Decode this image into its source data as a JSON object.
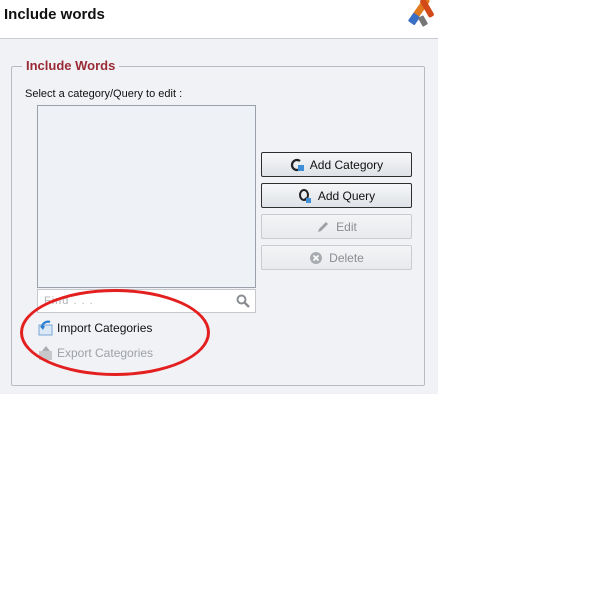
{
  "window": {
    "title": "Include words",
    "title_icon": "paintbrush-tools-icon"
  },
  "group": {
    "title": "Include Words"
  },
  "category_list": {
    "label": "Select a category/Query to edit :",
    "items": []
  },
  "find": {
    "placeholder": "Find . . .",
    "value": "",
    "icon": "search-icon"
  },
  "buttons": {
    "add_category": {
      "label": "Add Category",
      "icon": "add-category-icon",
      "enabled": true
    },
    "add_query": {
      "label": "Add Query",
      "icon": "add-query-icon",
      "enabled": true
    },
    "edit": {
      "label": "Edit",
      "icon": "pencil-icon",
      "enabled": false
    },
    "delete": {
      "label": "Delete",
      "icon": "delete-icon",
      "enabled": false
    }
  },
  "links": {
    "import": {
      "label": "Import Categories",
      "icon": "import-icon",
      "enabled": true
    },
    "export": {
      "label": "Export Categories",
      "icon": "export-icon",
      "enabled": false
    }
  },
  "colors": {
    "group_title": "#9a2a36",
    "annotation": "#e41f1f",
    "panel_background": "#f0f2f5"
  }
}
